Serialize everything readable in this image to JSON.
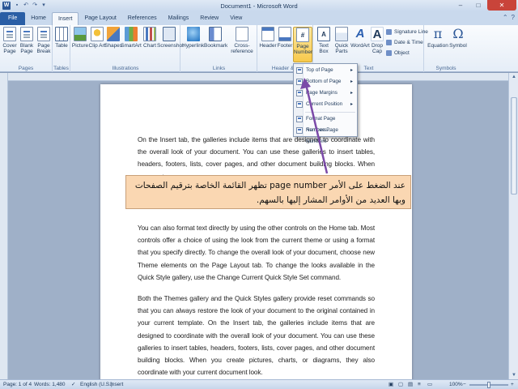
{
  "window": {
    "title": "Document1 - Microsoft Word",
    "app_icon": "W",
    "qat": [
      "save-icon",
      "undo-icon",
      "redo-icon",
      "customize-icon"
    ],
    "controls": [
      "–",
      "□",
      "✕"
    ]
  },
  "tabs": {
    "file": "File",
    "home": "Home",
    "insert": "Insert",
    "page_layout": "Page Layout",
    "references": "References",
    "mailings": "Mailings",
    "review": "Review",
    "view": "View"
  },
  "ribbon": {
    "pages": {
      "label": "Pages",
      "cover": "Cover Page",
      "blank": "Blank Page",
      "break": "Page Break"
    },
    "tables": {
      "label": "Tables",
      "table": "Table"
    },
    "illustrations": {
      "label": "Illustrations",
      "picture": "Picture",
      "clip_art": "Clip Art",
      "shapes": "Shapes",
      "smartart": "SmartArt",
      "chart": "Chart",
      "screenshot": "Screenshot"
    },
    "links": {
      "label": "Links",
      "hyperlink": "Hyperlink",
      "bookmark": "Bookmark",
      "cross_reference": "Cross-reference"
    },
    "header_footer": {
      "label": "Header & F",
      "header": "Header",
      "footer": "Footer",
      "page_number": "Page Number"
    },
    "text": {
      "label": "Text",
      "text_box": "Text Box",
      "quick_parts": "Quick Parts",
      "wordart": "WordArt",
      "drop_cap": "Drop Cap",
      "signature_line": "Signature Line",
      "date_time": "Date & Time",
      "object": "Object"
    },
    "symbols": {
      "label": "Symbols",
      "equation": "Equation",
      "symbol": "Symbol"
    }
  },
  "dropdown": {
    "items": [
      "Top of Page",
      "Bottom of Page",
      "Page Margins",
      "Current Position",
      "Format Page Numbers...",
      "Remove Page Numbers"
    ]
  },
  "document": {
    "paragraphs": [
      "On the Insert tab, the galleries include items that are designed to coordinate with the overall look of your document. You can use these galleries to insert tables, headers, footers, lists, cover pages, and other document building blocks. When you create",
      "You can also format text directly by using the other controls on the Home tab. Most controls offer a choice of using the look from the current theme or using a format that you specify directly. To change the overall look of your document, choose new Theme elements on the Page Layout tab. To change the looks available in the Quick Style gallery, use the Change Current Quick Style Set command.",
      "Both the Themes gallery and the Quick Styles gallery provide reset commands so that you can always restore the look of your document to the original contained in your current template. On the Insert tab, the galleries include items that are designed to coordinate with the overall look of your document. You can use these galleries to insert tables, headers, footers, lists, cover pages, and other document building blocks. When you create pictures, charts, or diagrams, they also coordinate with your current document look."
    ]
  },
  "callout": {
    "text": "عند الضغط على الأمر page number تظهر القائمة الخاصة بترقيم الصفحات وبها العديد من الأوامر المشار إليها بالسهم."
  },
  "status": {
    "page": "Page: 1 of 4",
    "words": "Words: 1,480",
    "language": "English (U.S.)",
    "mode": "Insert",
    "zoom": "100%",
    "zoom_minus": "−",
    "zoom_plus": "+"
  },
  "colors": {
    "file_tab": "#2a5ea5",
    "callout_bg": "#fad7b2",
    "arrow": "#7b4aa8",
    "selected": "#f8c94b"
  }
}
